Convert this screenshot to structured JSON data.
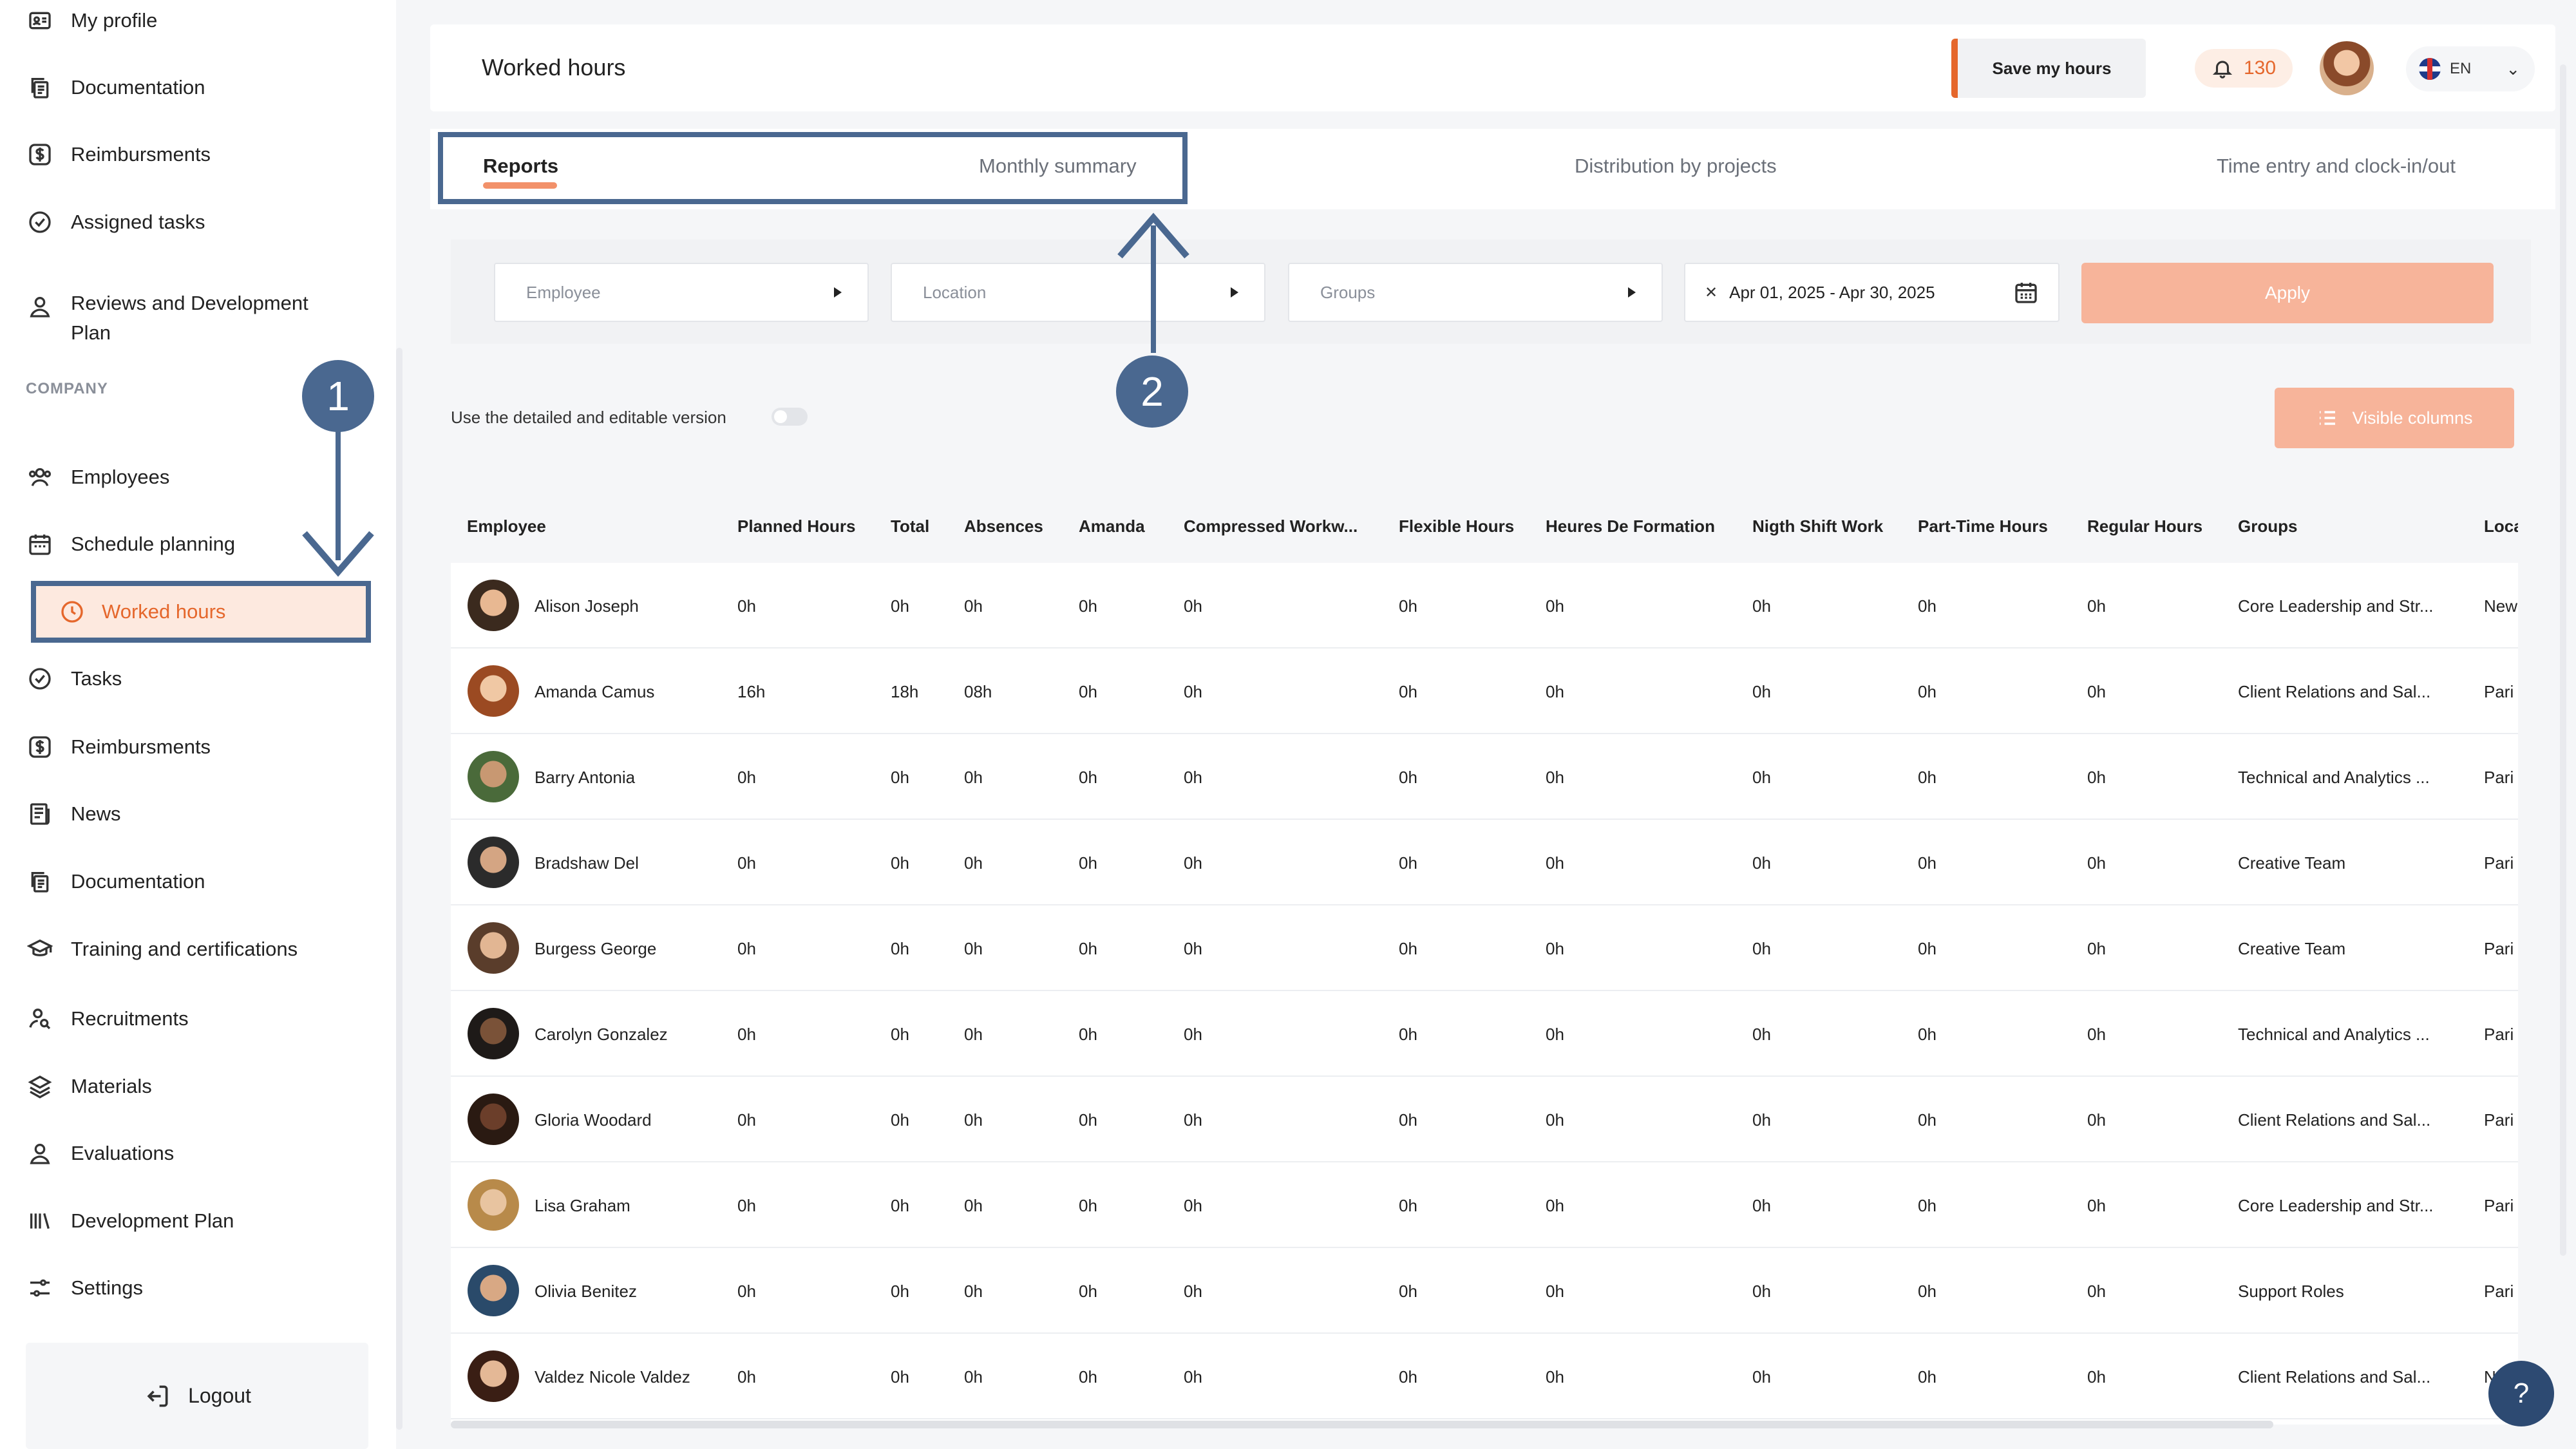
{
  "sidebar": {
    "top_items": [
      {
        "label": "My profile",
        "icon": "profile-card-icon"
      },
      {
        "label": "Documentation",
        "icon": "documents-icon"
      },
      {
        "label": "Reimbursments",
        "icon": "dollar-icon"
      },
      {
        "label": "Assigned tasks",
        "icon": "check-circle-icon"
      },
      {
        "label": "Reviews and Development Plan",
        "icon": "user-icon"
      }
    ],
    "section_label": "COMPANY",
    "company_items": [
      {
        "label": "Employees",
        "icon": "users-icon"
      },
      {
        "label": "Schedule planning",
        "icon": "calendar-icon"
      },
      {
        "label": "Worked hours",
        "icon": "clock-icon",
        "active": true
      },
      {
        "label": "Tasks",
        "icon": "check-circle-icon"
      },
      {
        "label": "Reimbursments",
        "icon": "dollar-icon"
      },
      {
        "label": "News",
        "icon": "news-icon"
      },
      {
        "label": "Documentation",
        "icon": "documents-icon"
      },
      {
        "label": "Training and certifications",
        "icon": "graduation-cap-icon"
      },
      {
        "label": "Recruitments",
        "icon": "user-search-icon"
      },
      {
        "label": "Materials",
        "icon": "layers-icon"
      },
      {
        "label": "Evaluations",
        "icon": "user-icon"
      },
      {
        "label": "Development Plan",
        "icon": "bars-icon"
      },
      {
        "label": "Settings",
        "icon": "sliders-icon"
      }
    ],
    "logout_label": "Logout"
  },
  "header": {
    "title": "Worked hours",
    "save_label": "Save my hours",
    "notification_count": "130",
    "language": "EN"
  },
  "tabs": [
    {
      "label": "Reports",
      "active": true
    },
    {
      "label": "Monthly summary"
    },
    {
      "label": "Distribution by projects"
    },
    {
      "label": "Time entry and clock-in/out"
    }
  ],
  "filters": {
    "employee_placeholder": "Employee",
    "location_placeholder": "Location",
    "groups_placeholder": "Groups",
    "date_range": "Apr 01, 2025 - Apr 30, 2025",
    "apply_label": "Apply"
  },
  "toggle_label": "Use the detailed and editable version",
  "visible_columns_label": "Visible columns",
  "annotations": {
    "step1": "1",
    "step2": "2"
  },
  "help_label": "?",
  "table": {
    "columns": [
      "Employee",
      "Planned Hours",
      "Total",
      "Absences",
      "Amanda",
      "Compressed Workw...",
      "Flexible Hours",
      "Heures De Formation",
      "Nigth Shift Work",
      "Part-Time Hours",
      "Regular Hours",
      "Groups",
      "Loca"
    ],
    "rows": [
      {
        "name": "Alison Joseph",
        "values": [
          "0h",
          "0h",
          "0h",
          "0h",
          "0h",
          "0h",
          "0h",
          "0h",
          "0h",
          "0h"
        ],
        "group": "Core Leadership and Str...",
        "loc": "New"
      },
      {
        "name": "Amanda Camus",
        "values": [
          "16h",
          "18h",
          "08h",
          "0h",
          "0h",
          "0h",
          "0h",
          "0h",
          "0h",
          "0h"
        ],
        "group": "Client Relations and Sal...",
        "loc": "Pari"
      },
      {
        "name": "Barry Antonia",
        "values": [
          "0h",
          "0h",
          "0h",
          "0h",
          "0h",
          "0h",
          "0h",
          "0h",
          "0h",
          "0h"
        ],
        "group": "Technical and Analytics ...",
        "loc": "Pari"
      },
      {
        "name": "Bradshaw Del",
        "values": [
          "0h",
          "0h",
          "0h",
          "0h",
          "0h",
          "0h",
          "0h",
          "0h",
          "0h",
          "0h"
        ],
        "group": "Creative Team",
        "loc": "Pari"
      },
      {
        "name": "Burgess George",
        "values": [
          "0h",
          "0h",
          "0h",
          "0h",
          "0h",
          "0h",
          "0h",
          "0h",
          "0h",
          "0h"
        ],
        "group": "Creative Team",
        "loc": "Pari"
      },
      {
        "name": "Carolyn Gonzalez",
        "values": [
          "0h",
          "0h",
          "0h",
          "0h",
          "0h",
          "0h",
          "0h",
          "0h",
          "0h",
          "0h"
        ],
        "group": "Technical and Analytics ...",
        "loc": "Pari"
      },
      {
        "name": "Gloria Woodard",
        "values": [
          "0h",
          "0h",
          "0h",
          "0h",
          "0h",
          "0h",
          "0h",
          "0h",
          "0h",
          "0h"
        ],
        "group": "Client Relations and Sal...",
        "loc": "Pari"
      },
      {
        "name": "Lisa Graham",
        "values": [
          "0h",
          "0h",
          "0h",
          "0h",
          "0h",
          "0h",
          "0h",
          "0h",
          "0h",
          "0h"
        ],
        "group": "Core Leadership and Str...",
        "loc": "Pari"
      },
      {
        "name": "Olivia Benitez",
        "values": [
          "0h",
          "0h",
          "0h",
          "0h",
          "0h",
          "0h",
          "0h",
          "0h",
          "0h",
          "0h"
        ],
        "group": "Support Roles",
        "loc": "Pari"
      },
      {
        "name": "Valdez Nicole Valdez",
        "values": [
          "0h",
          "0h",
          "0h",
          "0h",
          "0h",
          "0h",
          "0h",
          "0h",
          "0h",
          "0h"
        ],
        "group": "Client Relations and Sal...",
        "loc": "N"
      }
    ]
  },
  "colors": {
    "accent": "#e5672c",
    "annotation": "#4a6890",
    "button_light": "#f7b49a"
  }
}
